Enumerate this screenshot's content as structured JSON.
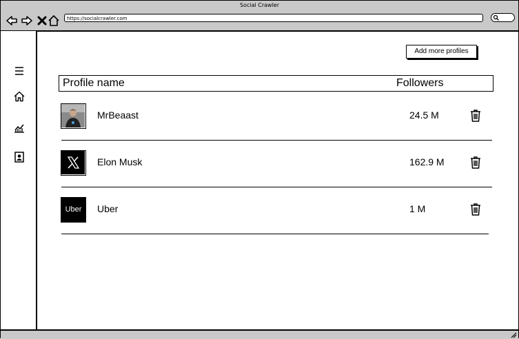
{
  "window": {
    "title": "Social Crawler"
  },
  "browser": {
    "url": "https://socialcrawler.com"
  },
  "icons": {
    "back": "back-arrow-icon",
    "forward": "forward-arrow-icon",
    "stop": "close-icon",
    "home": "home-icon",
    "search": "search-icon",
    "menu": "hamburger-menu-icon",
    "dashboard": "home-icon",
    "analytics": "line-chart-icon",
    "profile": "contact-card-icon",
    "delete": "trash-icon"
  },
  "actions": {
    "add_profiles_label": "Add more profiles"
  },
  "table": {
    "headers": {
      "name": "Profile name",
      "followers": "Followers"
    },
    "rows": [
      {
        "name": "MrBeaast",
        "followers": "24.5 M",
        "avatar": "photo"
      },
      {
        "name": "Elon Musk",
        "followers": "162.9 M",
        "avatar": "x-logo"
      },
      {
        "name": "Uber",
        "followers": "1 M",
        "avatar": "uber-logo",
        "logo_text": "Uber"
      }
    ]
  }
}
